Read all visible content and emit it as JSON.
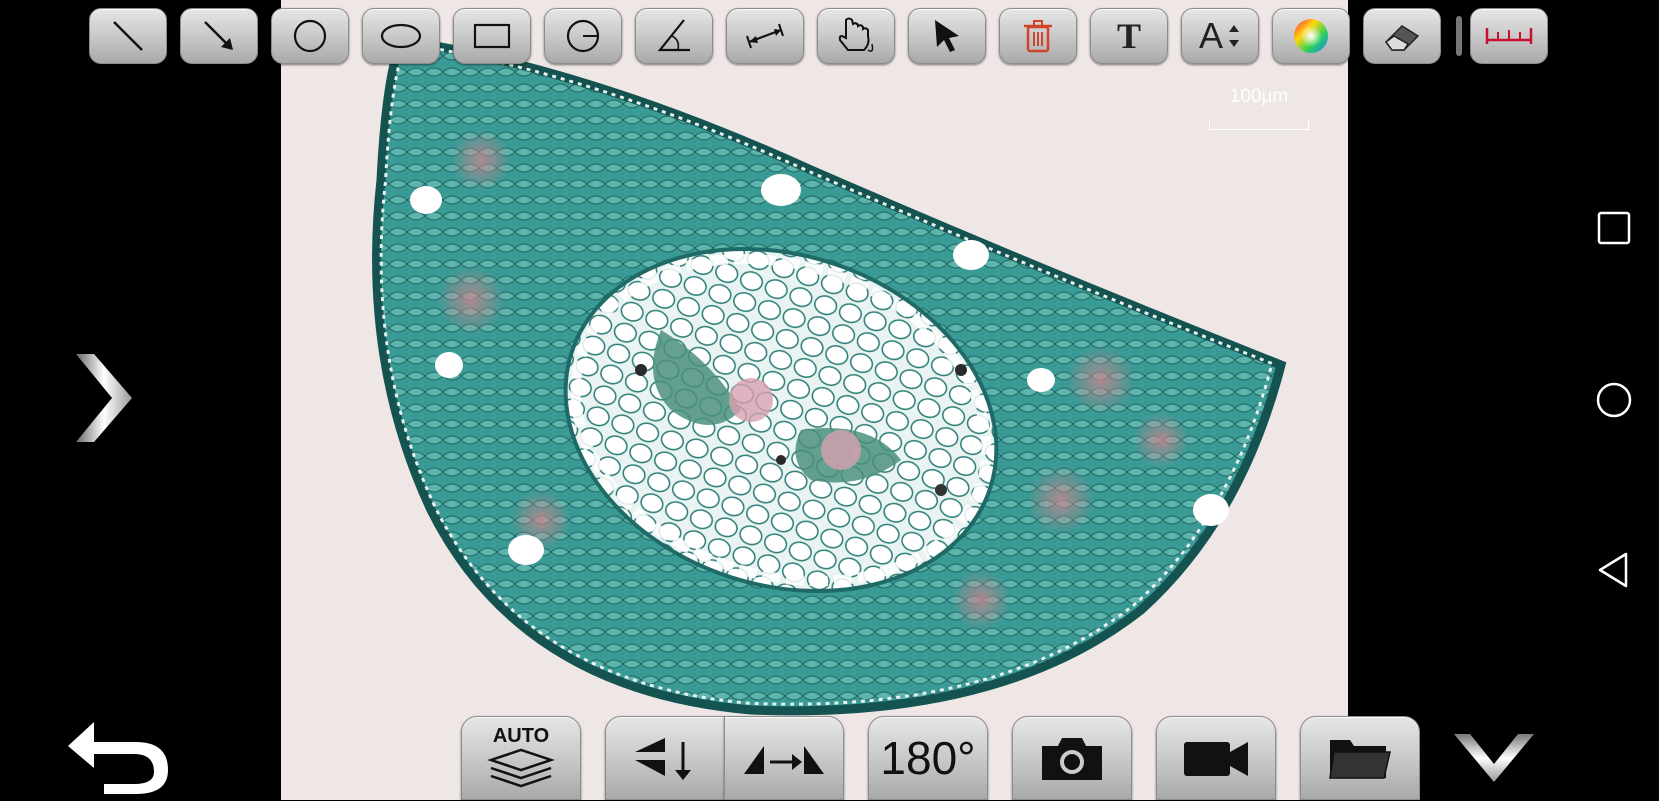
{
  "toolbar": {
    "tools": [
      {
        "name": "line-tool",
        "icon": "line-icon"
      },
      {
        "name": "arrow-tool",
        "icon": "arrow-icon"
      },
      {
        "name": "circle-tool",
        "icon": "circle-icon"
      },
      {
        "name": "ellipse-tool",
        "icon": "ellipse-icon"
      },
      {
        "name": "rectangle-tool",
        "icon": "rectangle-icon"
      },
      {
        "name": "three-point-circle-tool",
        "icon": "circle-radius-icon"
      },
      {
        "name": "angle-tool",
        "icon": "angle-icon"
      },
      {
        "name": "distance-tool",
        "icon": "distance-icon"
      },
      {
        "name": "freehand-tool",
        "icon": "hand-pointer-icon"
      },
      {
        "name": "select-tool",
        "icon": "cursor-icon"
      },
      {
        "name": "delete-tool",
        "icon": "trash-icon"
      },
      {
        "name": "text-tool",
        "icon": "text-icon",
        "label": "T"
      },
      {
        "name": "font-size-tool",
        "icon": "font-size-icon",
        "label": "A"
      },
      {
        "name": "color-tool",
        "icon": "color-wheel-icon"
      },
      {
        "name": "eraser-tool",
        "icon": "eraser-icon"
      },
      {
        "name": "calibration-tool",
        "icon": "ruler-icon"
      }
    ],
    "accent_red": "#c8102e"
  },
  "viewport": {
    "scale_label": "100μm",
    "background": "#efe6e6",
    "tissue_color": "#2f8a86"
  },
  "bottom_bar": {
    "auto_label": "AUTO",
    "rotate_label": "180°",
    "buttons": [
      "auto-stack",
      "flip-vertical",
      "flip-horizontal",
      "rotate-180",
      "snapshot",
      "record-video",
      "open-folder"
    ]
  },
  "side_nav": {
    "left": [
      "expand-chevron",
      "back-arrow"
    ],
    "right": [
      "collapse-chevron"
    ]
  },
  "system_nav": [
    "recent-apps",
    "home",
    "back"
  ]
}
